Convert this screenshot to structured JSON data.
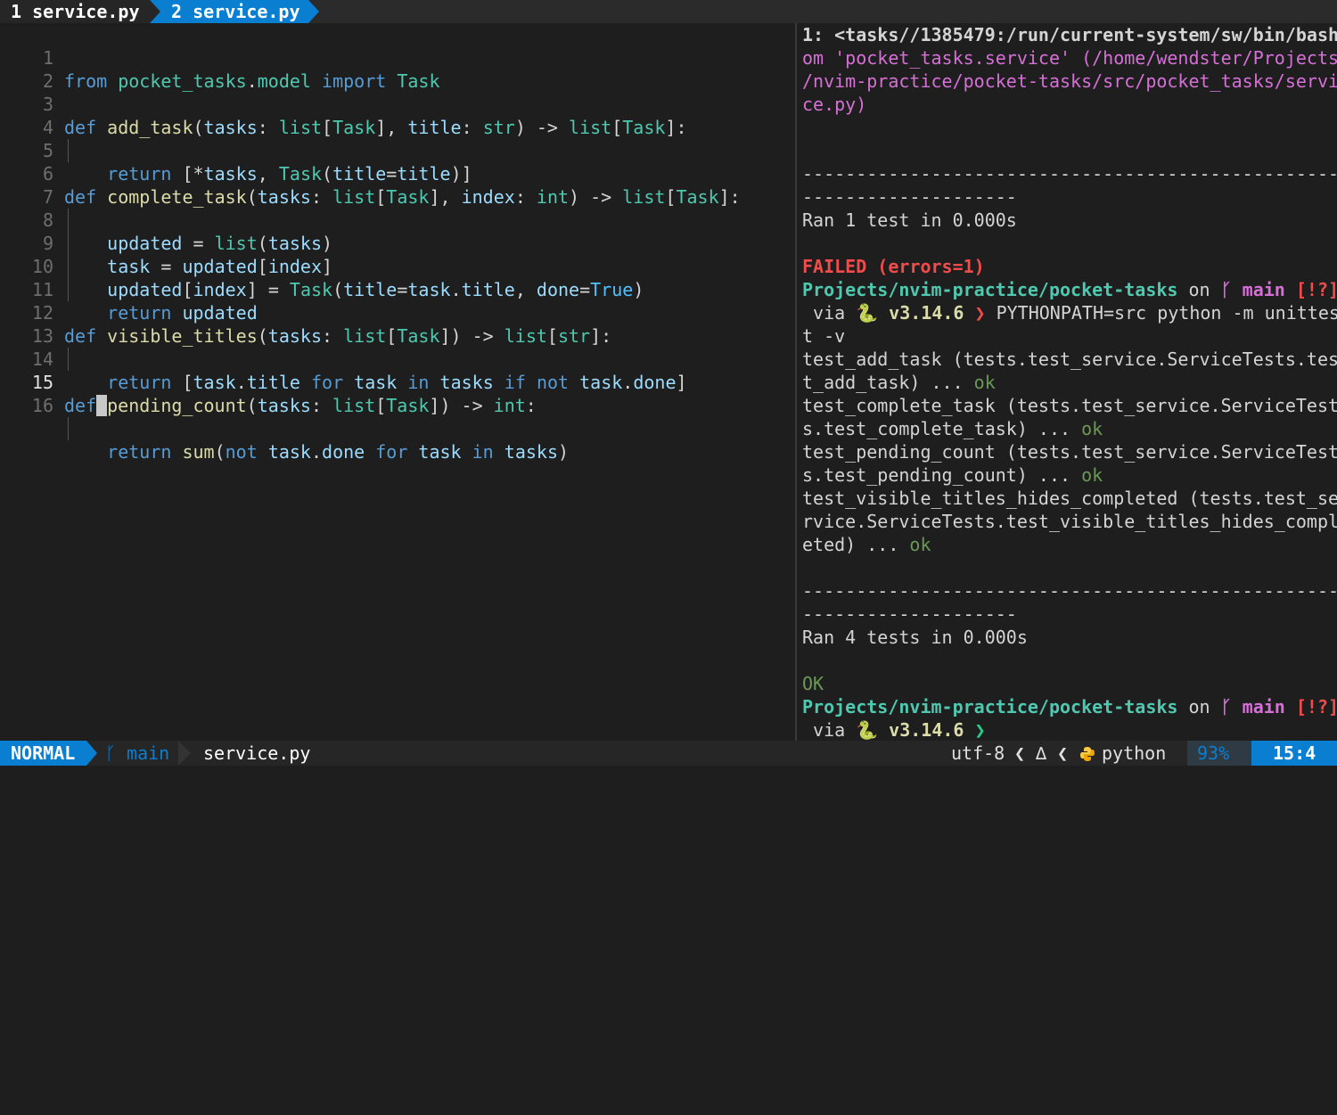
{
  "tabs": [
    {
      "label": "1 service.py"
    },
    {
      "label": "2 service.py"
    }
  ],
  "editor": {
    "line_numbers": [
      "1",
      "2",
      "3",
      "4",
      "5",
      "6",
      "7",
      "8",
      "9",
      "10",
      "11",
      "12",
      "13",
      "14",
      "15",
      "16"
    ],
    "lines": [
      "from pocket_tasks.model import Task",
      "",
      "def add_task(tasks: list[Task], title: str) -> list[Task]:",
      "return [*tasks, Task(title=title)]",
      "",
      "def complete_task(tasks: list[Task], index: int) -> list[Task]:",
      "updated = list(tasks)",
      "task = updated[index]",
      "updated[index] = Task(title=task.title, done=True)",
      "return updated",
      "",
      "def visible_titles(tasks: list[Task]) -> list[str]:",
      "return [task.title for task in tasks if not task.done]",
      "",
      "def pending_count(tasks: list[Task]) -> int:",
      "return sum(not task.done for task in tasks)"
    ]
  },
  "terminal": {
    "lines": [
      "1: <tasks//1385479:/run/current-system/sw/bin/bash",
      "om 'pocket_tasks.service' (/home/wendster/Projects",
      "/nvim-practice/pocket-tasks/src/pocket_tasks/servi",
      "ce.py)",
      "",
      "",
      "--------------------------------------------------",
      "--------------------",
      "Ran 1 test in 0.000s",
      "",
      "FAILED (errors=1)",
      "Projects/nvim-practice/pocket-tasks on  main [!?]",
      " via 🐍 v3.14.6 ❯ PYTHONPATH=src python -m unittes",
      "t -v",
      "test_add_task (tests.test_service.ServiceTests.tes",
      "t_add_task) ... ok",
      "test_complete_task (tests.test_service.ServiceTest",
      "s.test_complete_task) ... ok",
      "test_pending_count (tests.test_service.ServiceTest",
      "s.test_pending_count) ... ok",
      "test_visible_titles_hides_completed (tests.test_se",
      "rvice.ServiceTests.test_visible_titles_hides_compl",
      "eted) ... ok",
      "",
      "--------------------------------------------------",
      "--------------------",
      "Ran 4 tests in 0.000s",
      "",
      "OK",
      "Projects/nvim-practice/pocket-tasks on  main [!?]",
      " via 🐍 v3.14.6 ❯"
    ]
  },
  "statusline": {
    "mode": "NORMAL",
    "branch": "main",
    "file": "service.py",
    "encoding": "utf-8",
    "filetype": "python",
    "percent": "93%",
    "position": "15:4"
  },
  "colors": {
    "accent": "#0a7fd1",
    "keyword": "#569cd6",
    "function": "#dcdcaa",
    "type": "#4ec9b0",
    "error": "#f14c4c",
    "ok": "#23d18b",
    "prompt_branch": "#d670d6"
  },
  "icons": [
    "git-branch-icon",
    "linux-icon",
    "python-icon",
    "snake-icon"
  ]
}
